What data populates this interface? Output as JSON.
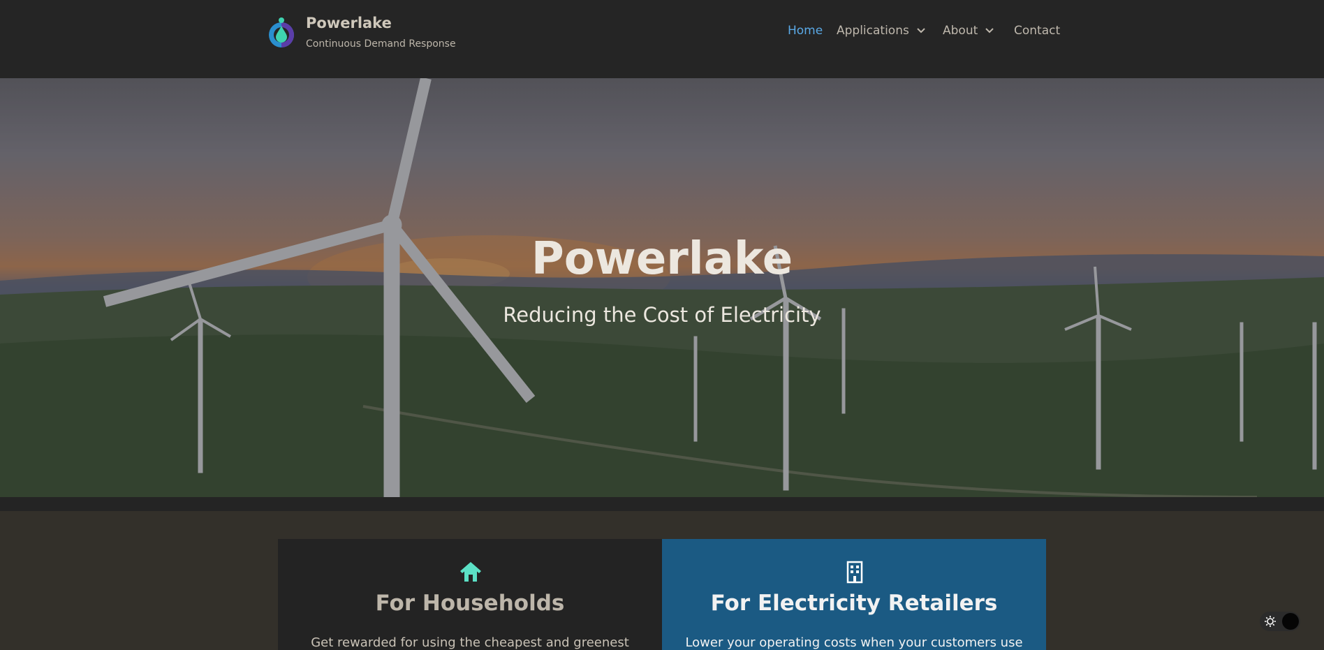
{
  "brand": {
    "name": "Powerlake",
    "tagline": "Continuous Demand Response",
    "logo_icon": "water-drop-logo"
  },
  "nav": {
    "home": "Home",
    "applications": "Applications",
    "about": "About",
    "contact": "Contact",
    "active": "Home",
    "active_color": "#5aa9e6"
  },
  "hero": {
    "title": "Powerlake",
    "subtitle": "Reducing the Cost of Electricity",
    "background": "wind-turbines-at-sunset"
  },
  "cards": [
    {
      "icon": "house-icon",
      "icon_color": "#5ce1c6",
      "title": "For Households",
      "text": "Get rewarded for using the cheapest and greenest"
    },
    {
      "icon": "building-icon",
      "icon_color": "#ffffff",
      "title": "For Electricity Retailers",
      "text": "Lower your operating costs when your customers use",
      "background": "#1b5a83"
    }
  ],
  "theme_toggle": {
    "icon": "sun-icon",
    "state": "dark"
  }
}
